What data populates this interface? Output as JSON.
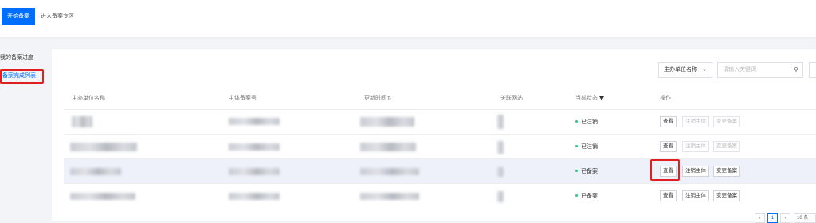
{
  "topbar": {
    "start_button": "开始备案",
    "enter_link": "进入备案专区"
  },
  "sidebar": {
    "items": [
      {
        "label": "我的备案进度"
      },
      {
        "label": "备案完成列表"
      }
    ]
  },
  "toolbar": {
    "select_value": "主办单位名称",
    "search_placeholder": "请输入关键词"
  },
  "table": {
    "headers": [
      "主办单位名称",
      "主体备案号",
      "更新时间",
      "关联网站",
      "当前状态",
      "操作"
    ],
    "rows": [
      {
        "status": "已注销",
        "actions": [
          {
            "label": "查看",
            "disabled": false
          },
          {
            "label": "注销主体",
            "disabled": true
          },
          {
            "label": "变更备案",
            "disabled": true
          }
        ]
      },
      {
        "status": "已注销",
        "actions": [
          {
            "label": "查看",
            "disabled": false
          },
          {
            "label": "注销主体",
            "disabled": true
          },
          {
            "label": "变更备案",
            "disabled": true
          }
        ]
      },
      {
        "status": "已备案",
        "actions": [
          {
            "label": "查看",
            "disabled": false
          },
          {
            "label": "注销主体",
            "disabled": false
          },
          {
            "label": "变更备案",
            "disabled": false
          }
        ]
      },
      {
        "status": "已备案",
        "actions": [
          {
            "label": "查看",
            "disabled": false
          },
          {
            "label": "注销主体",
            "disabled": false
          },
          {
            "label": "变更备案",
            "disabled": false
          }
        ]
      }
    ]
  },
  "pagination": {
    "current_page": "1",
    "page_size": "10 条"
  },
  "colors": {
    "primary": "#006eff",
    "highlight_border": "#e02020",
    "status_dot": "#29cc85"
  }
}
